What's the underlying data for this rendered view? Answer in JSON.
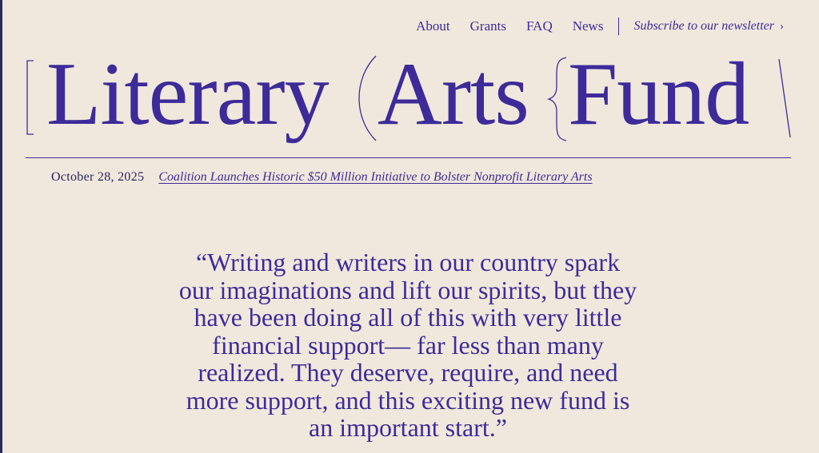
{
  "nav": {
    "items": [
      "About",
      "Grants",
      "FAQ",
      "News"
    ],
    "newsletter_label": "Subscribe to our newsletter",
    "newsletter_chevron": "›"
  },
  "logo": {
    "words": [
      "Literary",
      "Arts",
      "Fund"
    ]
  },
  "news": {
    "date": "October 28, 2025",
    "headline": "Coalition Launches Historic $50 Million Initiative to Bolster Nonprofit Literary Arts"
  },
  "quote": {
    "lines": [
      "“Writing and writers in our country spark",
      "our imaginations and lift our spirits, but they",
      "have been doing all of this with very little",
      "financial support— far less than many",
      "realized. They deserve, require, and need",
      "more support, and this exciting new fund is",
      "an important start.”"
    ]
  },
  "colors": {
    "background": "#f0e8dc",
    "accent": "#3d2b9a"
  }
}
